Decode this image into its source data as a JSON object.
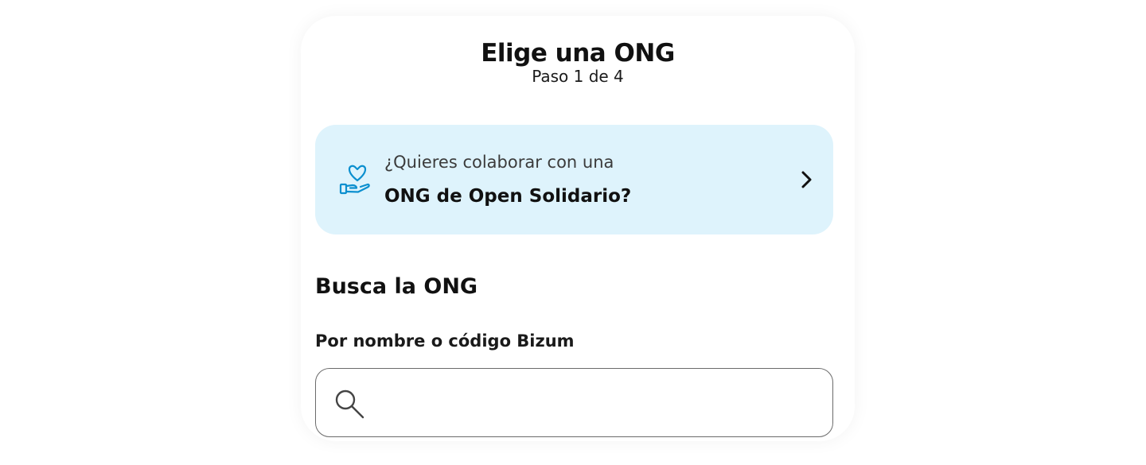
{
  "header": {
    "title": "Elige una ONG",
    "step": "Paso 1 de 4"
  },
  "banner": {
    "icon": "heart-hand-icon",
    "line1": "¿Quieres colaborar con una",
    "line2": "ONG de Open Solidario?",
    "chevron_icon": "chevron-right-icon",
    "background_color": "#def3fc",
    "icon_color": "#0b8fcf"
  },
  "search": {
    "section_title": "Busca la ONG",
    "field_label": "Por nombre o código Bizum",
    "value": "",
    "icon": "search-icon"
  }
}
